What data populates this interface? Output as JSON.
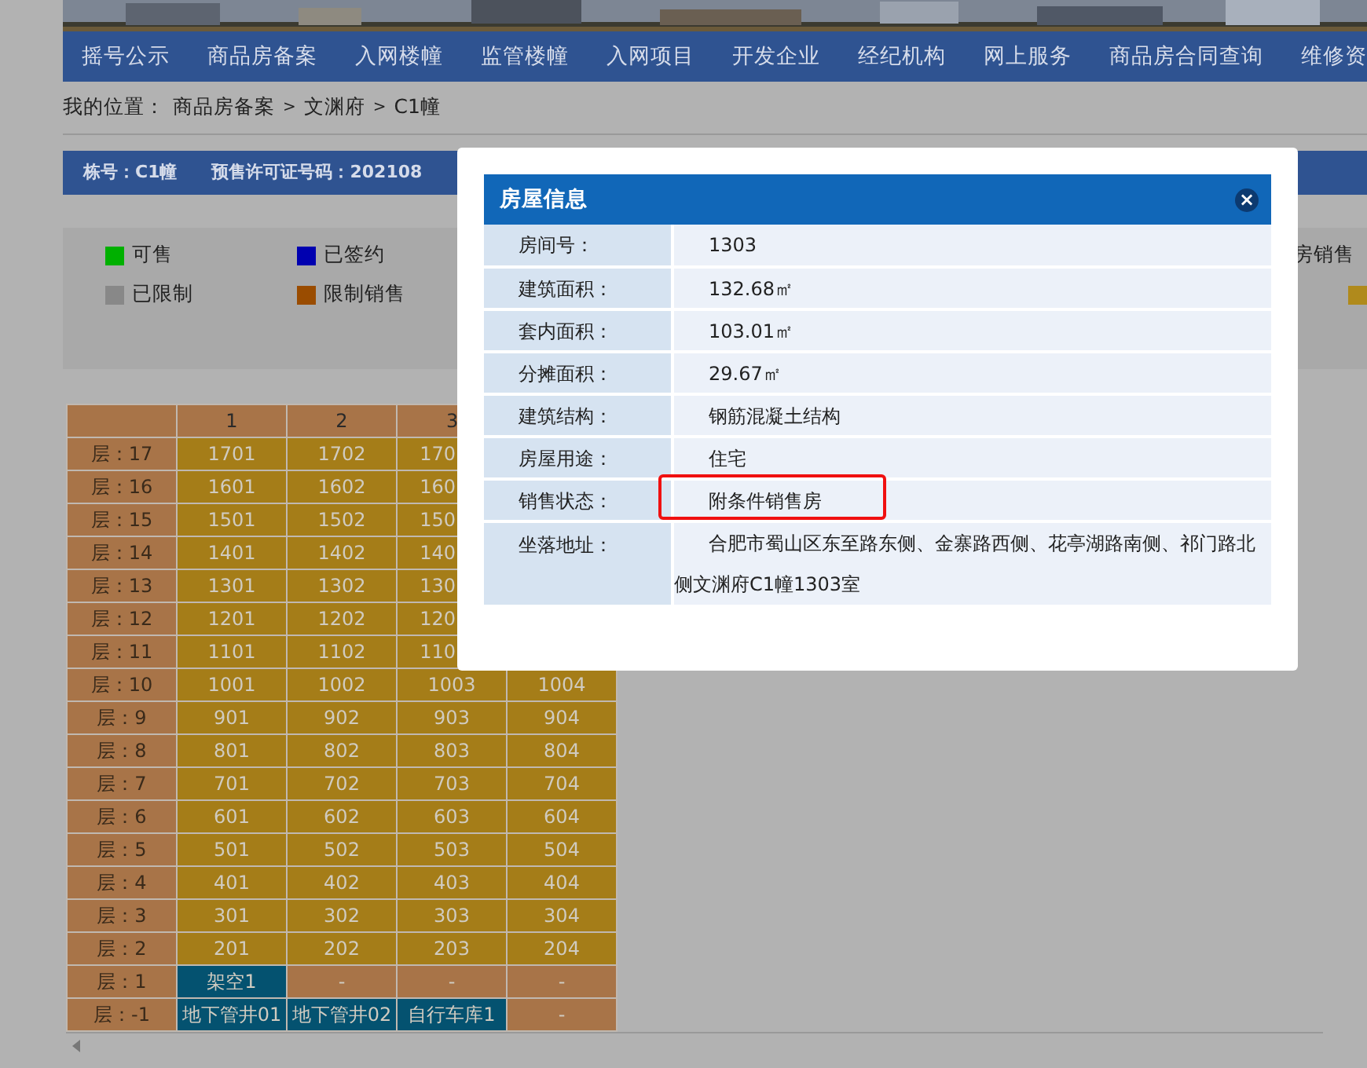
{
  "banner": {
    "kind": "picture"
  },
  "nav": [
    {
      "label": "摇号公示"
    },
    {
      "label": "商品房备案"
    },
    {
      "label": "入网楼幢"
    },
    {
      "label": "监管楼幢"
    },
    {
      "label": "入网项目"
    },
    {
      "label": "开发企业"
    },
    {
      "label": "经纪机构"
    },
    {
      "label": "网上服务"
    },
    {
      "label": "商品房合同查询"
    },
    {
      "label": "维修资"
    }
  ],
  "breadcrumb": {
    "label": "我的位置：",
    "items": [
      "商品房备案",
      "文渊府",
      "C1幢"
    ],
    "separator": ">"
  },
  "info_bar": [
    "栋号：C1幢",
    "预售许可证号码：202108"
  ],
  "legend": [
    {
      "label": "可售",
      "color": "#00b000"
    },
    {
      "label": "已签约",
      "color": "#0000b0"
    },
    {
      "label": "房销售"
    },
    {
      "label": "已限制",
      "color": "#888888"
    },
    {
      "label": "限制销售",
      "color": "#9a4c00"
    },
    {
      "color": "#b08a1c"
    }
  ],
  "table": {
    "columns": [
      "1",
      "2",
      "3"
    ],
    "rows": [
      {
        "floor": "层：17",
        "cells": [
          {
            "text": "1701",
            "color": "#a57d18"
          },
          {
            "text": "1702",
            "color": "#a57d18"
          },
          {
            "text": "170",
            "color": "#a57d18"
          }
        ]
      },
      {
        "floor": "层：16",
        "cells": [
          {
            "text": "1601",
            "color": "#a57d18"
          },
          {
            "text": "1602",
            "color": "#a57d18"
          },
          {
            "text": "160",
            "color": "#a57d18"
          }
        ]
      },
      {
        "floor": "层：15",
        "cells": [
          {
            "text": "1501",
            "color": "#a57d18"
          },
          {
            "text": "1502",
            "color": "#a57d18"
          },
          {
            "text": "150",
            "color": "#a57d18"
          }
        ]
      },
      {
        "floor": "层：14",
        "cells": [
          {
            "text": "1401",
            "color": "#a57d18"
          },
          {
            "text": "1402",
            "color": "#a57d18"
          },
          {
            "text": "140",
            "color": "#a57d18"
          }
        ]
      },
      {
        "floor": "层：13",
        "cells": [
          {
            "text": "1301",
            "color": "#a57d18"
          },
          {
            "text": "1302",
            "color": "#a57d18"
          },
          {
            "text": "130",
            "color": "#a57d18"
          }
        ]
      },
      {
        "floor": "层：12",
        "cells": [
          {
            "text": "1201",
            "color": "#a57d18"
          },
          {
            "text": "1202",
            "color": "#a57d18"
          },
          {
            "text": "120",
            "color": "#a57d18"
          }
        ]
      },
      {
        "floor": "层：11",
        "cells": [
          {
            "text": "1101",
            "color": "#a57d18"
          },
          {
            "text": "1102",
            "color": "#a57d18"
          },
          {
            "text": "110",
            "color": "#a57d18"
          }
        ]
      },
      {
        "floor": "层：10",
        "cells": [
          {
            "text": "1001",
            "color": "#a57d18"
          },
          {
            "text": "1002",
            "color": "#a57d18"
          },
          {
            "text": "1003",
            "color": "#a57d18"
          },
          {
            "text": "1004",
            "color": "#a57d18"
          }
        ]
      },
      {
        "floor": "层：9",
        "cells": [
          {
            "text": "901",
            "color": "#a57d18"
          },
          {
            "text": "902",
            "color": "#a57d18"
          },
          {
            "text": "903",
            "color": "#a57d18"
          },
          {
            "text": "904",
            "color": "#a57d18"
          }
        ]
      },
      {
        "floor": "层：8",
        "cells": [
          {
            "text": "801",
            "color": "#a57d18"
          },
          {
            "text": "802",
            "color": "#a57d18"
          },
          {
            "text": "803",
            "color": "#a57d18"
          },
          {
            "text": "804",
            "color": "#a57d18"
          }
        ]
      },
      {
        "floor": "层：7",
        "cells": [
          {
            "text": "701",
            "color": "#a57d18"
          },
          {
            "text": "702",
            "color": "#a57d18"
          },
          {
            "text": "703",
            "color": "#a57d18"
          },
          {
            "text": "704",
            "color": "#a57d18"
          }
        ]
      },
      {
        "floor": "层：6",
        "cells": [
          {
            "text": "601",
            "color": "#a57d18"
          },
          {
            "text": "602",
            "color": "#a57d18"
          },
          {
            "text": "603",
            "color": "#a57d18"
          },
          {
            "text": "604",
            "color": "#a57d18"
          }
        ]
      },
      {
        "floor": "层：5",
        "cells": [
          {
            "text": "501",
            "color": "#a57d18"
          },
          {
            "text": "502",
            "color": "#a57d18"
          },
          {
            "text": "503",
            "color": "#a57d18"
          },
          {
            "text": "504",
            "color": "#a57d18"
          }
        ]
      },
      {
        "floor": "层：4",
        "cells": [
          {
            "text": "401",
            "color": "#a57d18"
          },
          {
            "text": "402",
            "color": "#a57d18"
          },
          {
            "text": "403",
            "color": "#a57d18"
          },
          {
            "text": "404",
            "color": "#a57d18"
          }
        ]
      },
      {
        "floor": "层：3",
        "cells": [
          {
            "text": "301",
            "color": "#a57d18"
          },
          {
            "text": "302",
            "color": "#a57d18"
          },
          {
            "text": "303",
            "color": "#a57d18"
          },
          {
            "text": "304",
            "color": "#a57d18"
          }
        ]
      },
      {
        "floor": "层：2",
        "cells": [
          {
            "text": "201",
            "color": "#a57d18"
          },
          {
            "text": "202",
            "color": "#a57d18"
          },
          {
            "text": "203",
            "color": "#a57d18"
          },
          {
            "text": "204",
            "color": "#a57d18"
          }
        ]
      },
      {
        "floor": "层：1",
        "cells": [
          {
            "text": "架空1",
            "color": "#045270"
          },
          {
            "text": "-",
            "color": "#a87448"
          },
          {
            "text": "-",
            "color": "#a87448"
          },
          {
            "text": "-",
            "color": "#a87448"
          }
        ]
      },
      {
        "floor": "层：-1",
        "cells": [
          {
            "text": "地下管井01",
            "color": "#045270"
          },
          {
            "text": "地下管井02",
            "color": "#045270"
          },
          {
            "text": "自行车库1",
            "color": "#045270"
          },
          {
            "text": "-",
            "color": "#a87448"
          }
        ]
      }
    ]
  },
  "dialog": {
    "title": "房屋信息",
    "close": "×",
    "rows": [
      {
        "label": "房间号：",
        "value": "1303",
        "highlighted": false
      },
      {
        "label": "建筑面积：",
        "value": "132.68㎡",
        "highlighted": false
      },
      {
        "label": "套内面积：",
        "value": "103.01㎡",
        "highlighted": false
      },
      {
        "label": "分摊面积：",
        "value": "29.67㎡",
        "highlighted": false
      },
      {
        "label": "建筑结构：",
        "value": "钢筋混凝土结构",
        "highlighted": false
      },
      {
        "label": "房屋用途：",
        "value": "住宅",
        "highlighted": false
      },
      {
        "label": "销售状态：",
        "value": "附条件销售房",
        "highlighted": true
      },
      {
        "label": "坐落地址：",
        "value": "合肥市蜀山区东至路东侧、金寨路西侧、花亭湖路南侧、祁门路北侧文渊府C1幢1303室",
        "highlighted": false
      }
    ]
  }
}
